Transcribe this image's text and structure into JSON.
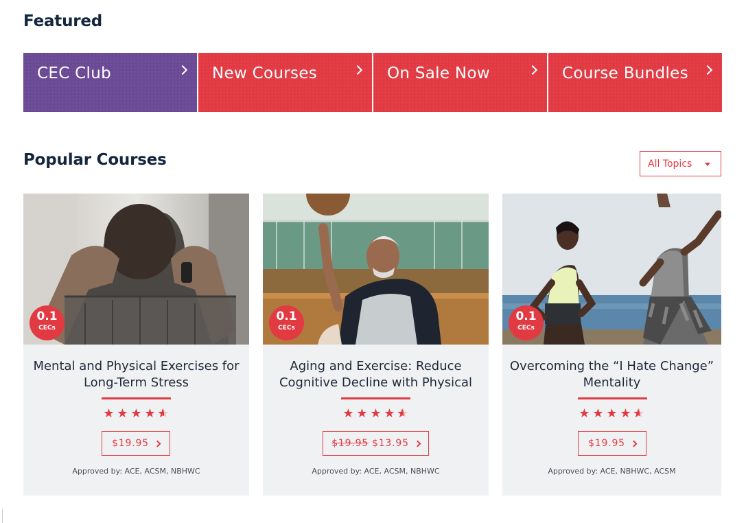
{
  "featured": {
    "title": "Featured",
    "tiles": [
      {
        "label": "CEC Club",
        "color": "#6b4a95"
      },
      {
        "label": "New Courses",
        "color": "#e23a43"
      },
      {
        "label": "On Sale Now",
        "color": "#e23a43"
      },
      {
        "label": "Course Bundles",
        "color": "#e23a43"
      }
    ]
  },
  "popular": {
    "title": "Popular Courses",
    "filter": {
      "selected": "All Topics"
    },
    "courses": [
      {
        "title": "Mental and Physical Exercises for Long-Term Stress",
        "cec_value": "0.1",
        "cec_unit": "CECs",
        "rating": 4.5,
        "price": "$19.95",
        "approved": "Approved by: ACE, ACSM, NBHWC",
        "image": "man-hands-behind-head-photo"
      },
      {
        "title": "Aging and Exercise: Reduce Cognitive Decline with Physical",
        "cec_value": "0.1",
        "cec_unit": "CECs",
        "rating": 4.5,
        "old_price": "$19.95",
        "price": "$13.95",
        "approved": "Approved by: ACE, ACSM, NBHWC",
        "image": "senior-man-basketball-photo"
      },
      {
        "title": "Overcoming the “I Hate Change” Mentality",
        "cec_value": "0.1",
        "cec_unit": "CECs",
        "rating": 4.5,
        "price": "$19.95",
        "approved": "Approved by: ACE, NBHWC, ACSM",
        "image": "women-beach-workout-photo"
      }
    ]
  },
  "colors": {
    "accent": "#e23a43",
    "club": "#6b4a95",
    "heading": "#14263d",
    "card_bg": "#f0f1f3"
  }
}
